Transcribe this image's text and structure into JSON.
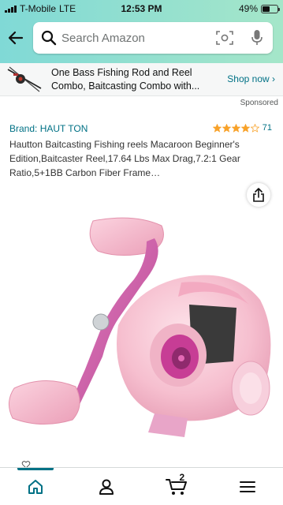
{
  "status_bar": {
    "carrier": "T-Mobile",
    "network": "LTE",
    "time": "12:53 PM",
    "battery": "49%",
    "battery_level": 0.49
  },
  "search": {
    "placeholder": "Search Amazon"
  },
  "banner": {
    "line1": "One Bass Fishing Rod and Reel",
    "line2": "Combo, Baitcasting Combo with...",
    "cta": "Shop now ›",
    "sponsored_label": "Sponsored"
  },
  "product": {
    "brand": "Brand: HAUT TON",
    "rating_value": 4,
    "rating_count": "71",
    "title": "Hautton Baitcasting Fishing reels Macaroon Beginner's Edition,Baitcaster Reel,17.64 Lbs Max Drag,7.2:1 Gear Ratio,5+1BB Carbon Fiber Frame…"
  },
  "tabbar": {
    "cart_count": "2",
    "items": [
      {
        "name": "home",
        "icon": "home-icon",
        "active": true
      },
      {
        "name": "account",
        "icon": "person-icon",
        "active": false
      },
      {
        "name": "cart",
        "icon": "cart-icon",
        "active": false
      },
      {
        "name": "menu",
        "icon": "menu-icon",
        "active": false
      }
    ]
  },
  "colors": {
    "accent": "#007185",
    "star": "#F8A22A",
    "header_start": "#80d9d6",
    "header_end": "#a5e6c9",
    "reel_pink": "#f6c3d1",
    "reel_magenta": "#d45aa3"
  }
}
